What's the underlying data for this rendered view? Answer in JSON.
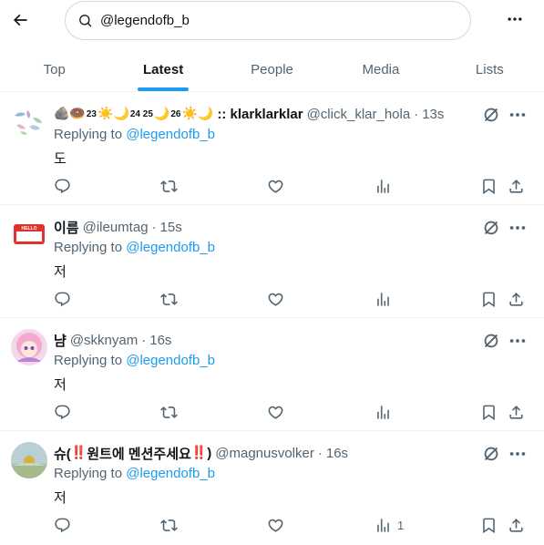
{
  "search": {
    "value": "@legendofb_b",
    "icon": "search-icon"
  },
  "tabs": [
    {
      "label": "Top",
      "active": false
    },
    {
      "label": "Latest",
      "active": true
    },
    {
      "label": "People",
      "active": false
    },
    {
      "label": "Media",
      "active": false
    },
    {
      "label": "Lists",
      "active": false
    }
  ],
  "colors": {
    "accent": "#1d9bf0",
    "muted": "#536471",
    "text": "#0f1419"
  },
  "tweets": [
    {
      "name_emoji": "🪨🍩",
      "sup1": "23",
      "sun1": "☀️",
      "moon1": "🌙",
      "sup2": "24 25",
      "moon2": "🌙",
      "sup3": "26",
      "sun2": "☀️",
      "moon3": "🌙",
      "name": ":: klarklarklar",
      "handle": "@click_klar_hola",
      "time": "13s",
      "replying_prefix": "Replying to",
      "replying_to": "@legendofb_b",
      "text": "도",
      "views": ""
    },
    {
      "name": "이름",
      "handle": "@ileumtag",
      "time": "15s",
      "replying_prefix": "Replying to",
      "replying_to": "@legendofb_b",
      "text": "저",
      "views": ""
    },
    {
      "name": "냠",
      "handle": "@skknyam",
      "time": "16s",
      "replying_prefix": "Replying to",
      "replying_to": "@legendofb_b",
      "text": "저",
      "views": ""
    },
    {
      "name_pre": "슈(",
      "name_bang1": "‼️",
      "name_mid": "원트에 멘션주세요",
      "name_bang2": "‼️",
      "name_post": ")",
      "handle": "@magnusvolker",
      "time": "16s",
      "replying_prefix": "Replying to",
      "replying_to": "@legendofb_b",
      "text": "저",
      "views": "1"
    }
  ]
}
